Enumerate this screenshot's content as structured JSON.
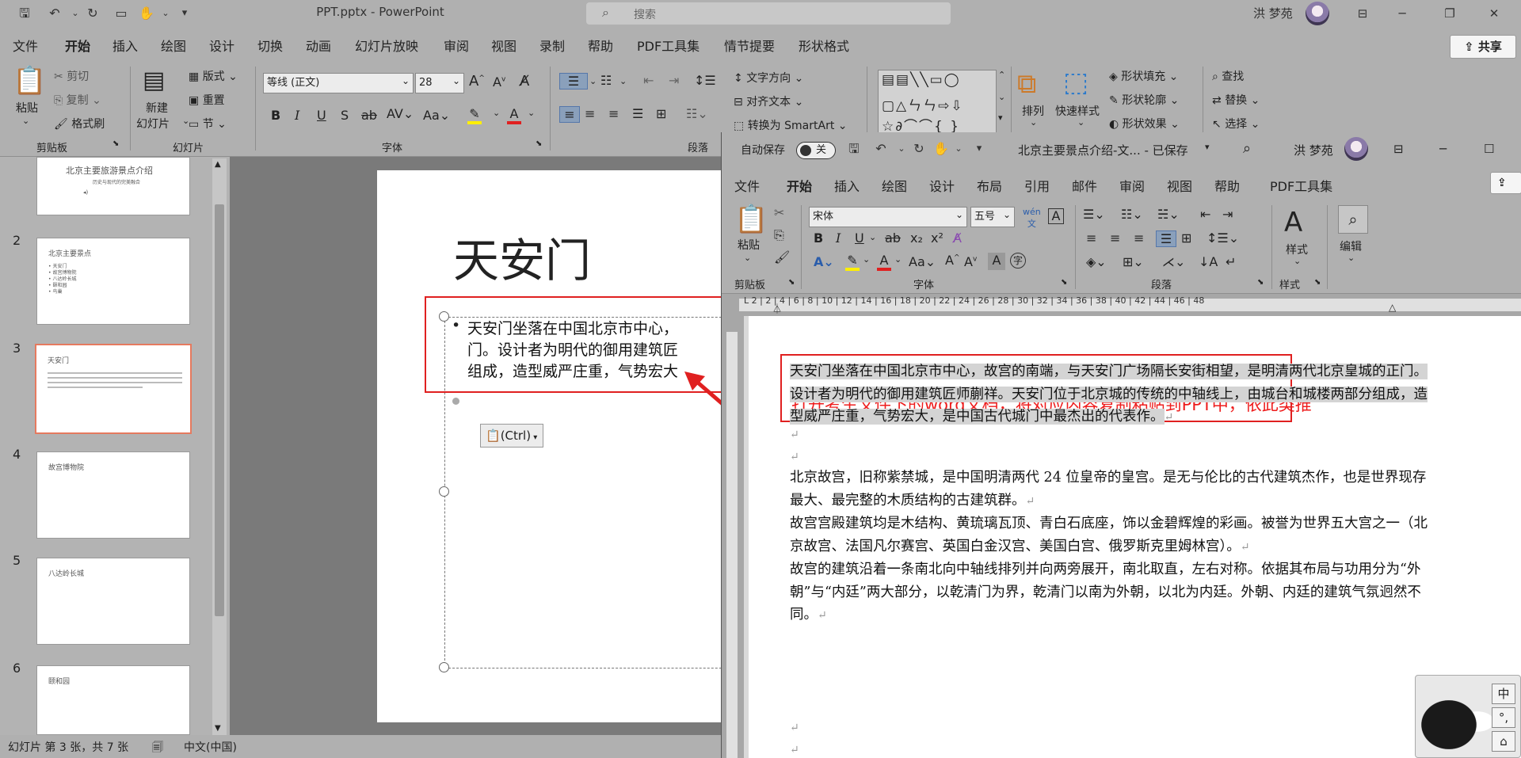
{
  "ppt": {
    "title": "PPT.pptx  -  PowerPoint",
    "search_placeholder": "搜索",
    "user": "洪 梦苑",
    "share": "共享",
    "menu": [
      "文件",
      "开始",
      "插入",
      "绘图",
      "设计",
      "切换",
      "动画",
      "幻灯片放映",
      "审阅",
      "视图",
      "录制",
      "帮助",
      "PDF工具集",
      "情节提要",
      "形状格式"
    ],
    "ribbon": {
      "paste": "粘贴",
      "cut": "剪切",
      "copy": "复制",
      "format_painter": "格式刷",
      "clipboard": "剪贴板",
      "new_slide_1": "新建",
      "new_slide_2": "幻灯片",
      "layout": "版式",
      "reset": "重置",
      "section": "节",
      "slides": "幻灯片",
      "font_name": "等线 (正文)",
      "font_size": "28",
      "font_group": "字体",
      "paragraph_group": "段落",
      "text_direction": "文字方向",
      "align_text": "对齐文本",
      "smartart": "转换为 SmartArt",
      "arrange": "排列",
      "quick_styles": "快速样式",
      "shape_fill": "形状填充",
      "shape_outline": "形状轮廓",
      "shape_effects": "形状效果",
      "find": "查找",
      "replace": "替换",
      "select": "选择"
    },
    "thumbs": [
      {
        "num": "",
        "title": "北京主要旅游景点介绍",
        "subtitle": "历史与现代的完美融合"
      },
      {
        "num": "2",
        "title": "北京主要景点",
        "items": [
          "天安门",
          "故宫博物院",
          "八达岭长城",
          "颐和园",
          "鸟巢"
        ]
      },
      {
        "num": "3",
        "title": "天安门"
      },
      {
        "num": "4",
        "title": "故宫博物院"
      },
      {
        "num": "5",
        "title": "八达岭长城"
      },
      {
        "num": "6",
        "title": "颐和园"
      }
    ],
    "slide": {
      "title": "天安门",
      "body": "天安门坐落在中国北京市中心，\n门。设计者为明代的御用建筑匠\n组成，造型威严庄重，气势宏大",
      "paste_tag": "(Ctrl)"
    },
    "status": {
      "slide_info": "幻灯片 第 3 张，共 7 张",
      "language": "中文(中国)"
    }
  },
  "word": {
    "autosave": "自动保存",
    "autosave_state": "关",
    "title": "北京主要景点介绍-文...  -  已保存",
    "user": "洪 梦苑",
    "menu": [
      "文件",
      "开始",
      "插入",
      "绘图",
      "设计",
      "布局",
      "引用",
      "邮件",
      "审阅",
      "视图",
      "帮助",
      "PDF工具集"
    ],
    "ribbon": {
      "paste": "粘贴",
      "clipboard": "剪贴板",
      "font_name": "宋体",
      "font_size": "五号",
      "font_group": "字体",
      "paragraph_group": "段落",
      "styles": "样式",
      "styles_group": "样式",
      "edit": "编辑"
    },
    "ruler": "L  2  |  2  |  4  |  6  |  8  |  10  |  12  |  14  |  16  |  18  |  20  |  22  |  24  |  26  |  28  |  30  |  32  |  34  |  36  |  38  |  40  |  42  |  44  |  46  |  48",
    "hint": "打开考生文件下的word文档，将对应内容复制粘贴到PPT中，依此类推",
    "para1": "天安门坐落在中国北京市中心，故宫的南端，与天安门广场隔长安街相望，是明清两代北京皇城的正门。设计者为明代的御用建筑匠师蒯祥。天安门位于北京城的传统的中轴线上，由城台和城楼两部分组成，造型威严庄重，气势宏大，是中国古代城门中最杰出的代表作。",
    "para2": "北京故宫，旧称紫禁城，是中国明清两代 24 位皇帝的皇宫。是无与伦比的古代建筑杰作，也是世界现存最大、最完整的木质结构的古建筑群。",
    "para3": "故宫宫殿建筑均是木结构、黄琉璃瓦顶、青白石底座，饰以金碧辉煌的彩画。被誉为世界五大宫之一（北京故宫、法国凡尔赛宫、英国白金汉宫、美国白宫、俄罗斯克里姆林宫）。",
    "para4": "故宫的建筑沿着一条南北向中轴线排列并向两旁展开，南北取直，左右对称。依据其布局与功用分为“外朝”与“内廷”两大部分，以乾清门为界，乾清门以南为外朝，以北为内廷。外朝、内廷的建筑气氛迥然不同。",
    "ime": [
      "中",
      "°,",
      "⌂"
    ]
  }
}
